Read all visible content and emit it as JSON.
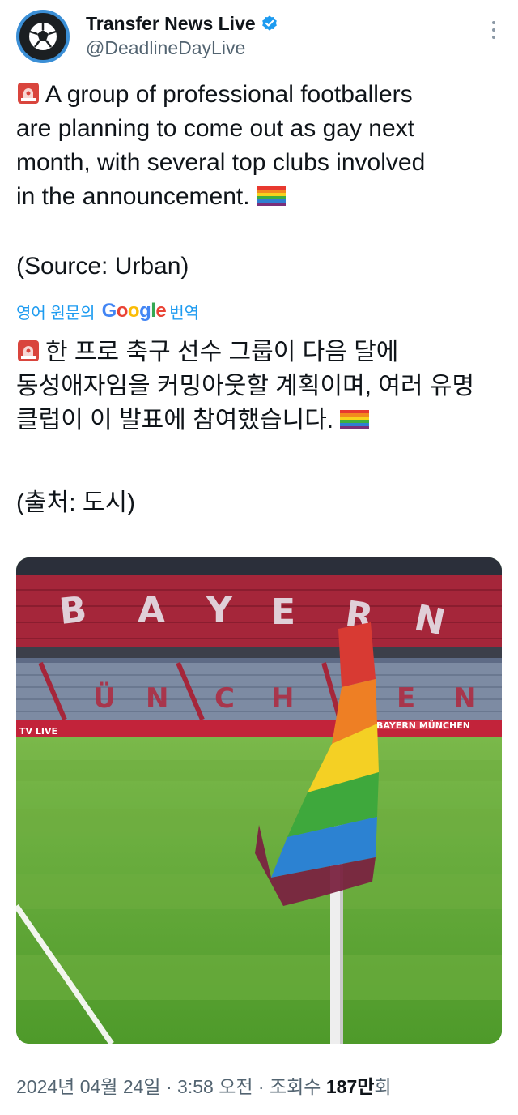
{
  "author": {
    "display_name": "Transfer News Live",
    "handle": "@DeadlineDayLive",
    "avatar_icon": "soccer-ball-icon",
    "verified_icon": "verified-badge-icon"
  },
  "tweet": {
    "lines": [
      "A group of professional footballers",
      "are planning to come out as gay next",
      "month, with several top clubs involved",
      "in the announcement."
    ],
    "source": "(Source: Urban)"
  },
  "translation": {
    "prefix": "영어 원문의",
    "provider": "Google",
    "suffix": "번역",
    "lines": [
      "한 프로 축구 선수 그룹이 다음 달에",
      "동성애자임을 커밍아웃할 계획이며, 여러 유명",
      "클럽이 이 발표에 참여했습니다."
    ],
    "source": "(출처: 도시)"
  },
  "media": {
    "stand_letters_top": [
      "B",
      "A",
      "Y",
      "E",
      "R",
      "N"
    ],
    "stand_letters_bottom": [
      "Ü",
      "N",
      "C",
      "H",
      "E",
      "N"
    ],
    "board_left": "TV LIVE",
    "board_right": "BAYERN MÜNCHEN"
  },
  "meta": {
    "date": "2024년 04월 24일",
    "separator1": "·",
    "time": "3:58 오전",
    "separator2": "·",
    "views_label": "조회수",
    "views_value": "187만",
    "views_unit": "회"
  },
  "colors": {
    "link_blue": "#1d9bf0",
    "secondary_text": "#536471",
    "verified_blue": "#1d9bf0",
    "flag_stripes": [
      "#e8392f",
      "#f28a1e",
      "#f7d21c",
      "#3fae3f",
      "#2f7fd1",
      "#7b2f7a"
    ]
  }
}
